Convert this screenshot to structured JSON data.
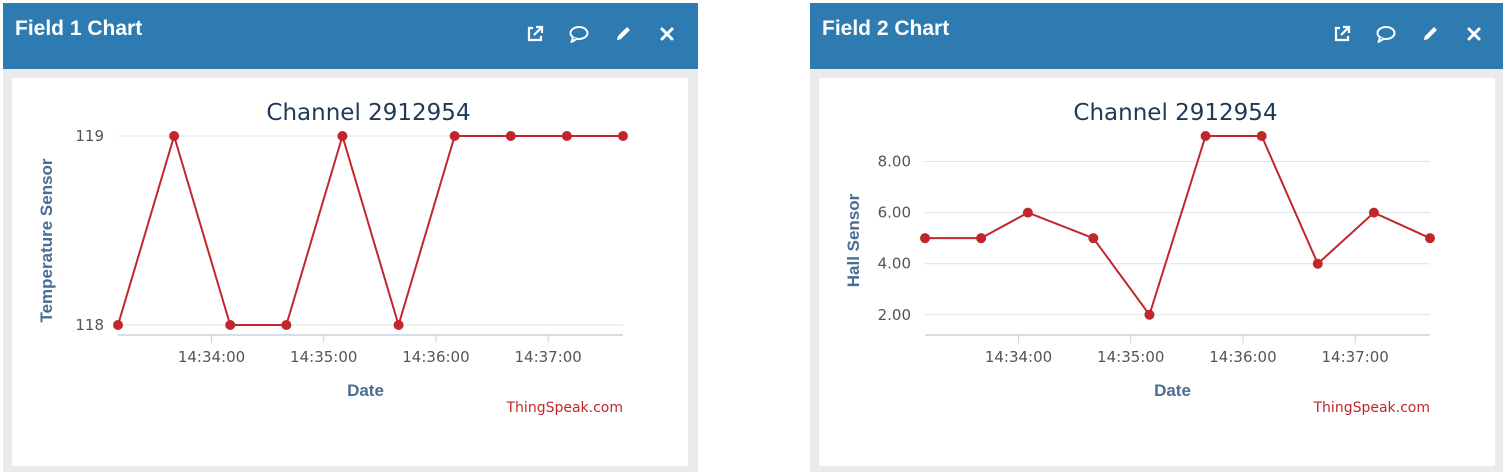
{
  "colors": {
    "header": "#2e7bb2",
    "series": "#c0272d",
    "grid": "#dde3ea",
    "axis_title": "#4a6d93"
  },
  "icons": [
    "external-link-icon",
    "comment-icon",
    "pencil-icon",
    "close-icon"
  ],
  "panels": [
    {
      "title": "Field 1 Chart"
    },
    {
      "title": "Field 2 Chart"
    }
  ],
  "chart_data": [
    {
      "type": "line",
      "title": "Channel 2912954",
      "xlabel": "Date",
      "ylabel": "Temperature Sensor",
      "credit": "ThingSpeak.com",
      "x": [
        "14:33:10",
        "14:33:40",
        "14:34:10",
        "14:34:40",
        "14:35:10",
        "14:35:40",
        "14:36:10",
        "14:36:40",
        "14:37:10",
        "14:37:40"
      ],
      "values": [
        118,
        119,
        118,
        118,
        119,
        118,
        119,
        119,
        119,
        119
      ],
      "xlim": [
        "14:33:10",
        "14:37:40"
      ],
      "ylim": [
        118,
        119
      ],
      "x_ticks": [
        "14:34:00",
        "14:35:00",
        "14:36:00",
        "14:37:00"
      ],
      "y_ticks": [
        118,
        119
      ],
      "y_tick_labels": [
        "118",
        "119"
      ],
      "grid": true,
      "legend": "none"
    },
    {
      "type": "line",
      "title": "Channel 2912954",
      "xlabel": "Date",
      "ylabel": "Hall Sensor",
      "credit": "ThingSpeak.com",
      "x": [
        "14:33:10",
        "14:33:40",
        "14:34:05",
        "14:34:40",
        "14:35:10",
        "14:35:40",
        "14:36:10",
        "14:36:40",
        "14:37:10",
        "14:37:40"
      ],
      "values": [
        5,
        5,
        6,
        5,
        2,
        9,
        9,
        4,
        6,
        5
      ],
      "xlim": [
        "14:33:10",
        "14:37:40"
      ],
      "ylim": [
        1.6,
        9
      ],
      "x_ticks": [
        "14:34:00",
        "14:35:00",
        "14:36:00",
        "14:37:00"
      ],
      "y_ticks": [
        2,
        4,
        6,
        8
      ],
      "y_tick_labels": [
        "2.00",
        "4.00",
        "6.00",
        "8.00"
      ],
      "grid": true,
      "legend": "none"
    }
  ]
}
